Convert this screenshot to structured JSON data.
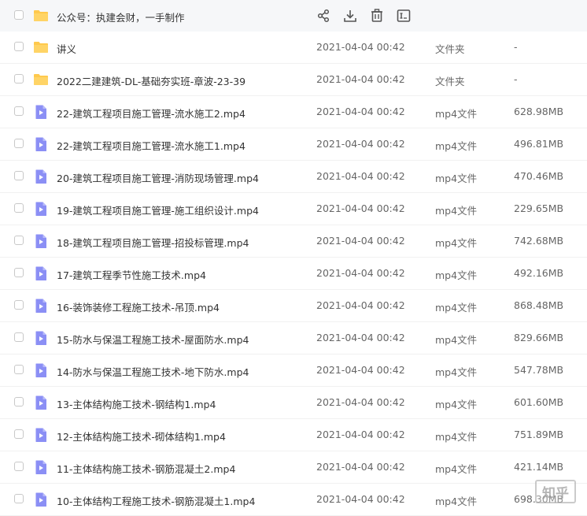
{
  "colors": {
    "folder": "#ffc94d",
    "video": "#8b8ff5",
    "selected_row_bg": "#f6f7f9"
  },
  "toolbar": {
    "icons": [
      "share-icon",
      "download-icon",
      "delete-icon",
      "rename-icon"
    ]
  },
  "rows": [
    {
      "name": "公众号：执建会财，一手制作",
      "kind": "folder",
      "date": "",
      "type": "",
      "size": ""
    },
    {
      "name": "讲义",
      "kind": "folder",
      "date": "2021-04-04 00:42",
      "type": "文件夹",
      "size": "-"
    },
    {
      "name": "2022二建建筑-DL-基础夯实班-章波-23-39",
      "kind": "folder",
      "date": "2021-04-04 00:42",
      "type": "文件夹",
      "size": "-"
    },
    {
      "name": "22-建筑工程项目施工管理-流水施工2.mp4",
      "kind": "video",
      "date": "2021-04-04 00:42",
      "type": "mp4文件",
      "size": "628.98MB"
    },
    {
      "name": "22-建筑工程项目施工管理-流水施工1.mp4",
      "kind": "video",
      "date": "2021-04-04 00:42",
      "type": "mp4文件",
      "size": "496.81MB"
    },
    {
      "name": "20-建筑工程项目施工管理-消防现场管理.mp4",
      "kind": "video",
      "date": "2021-04-04 00:42",
      "type": "mp4文件",
      "size": "470.46MB"
    },
    {
      "name": "19-建筑工程项目施工管理-施工组织设计.mp4",
      "kind": "video",
      "date": "2021-04-04 00:42",
      "type": "mp4文件",
      "size": "229.65MB"
    },
    {
      "name": "18-建筑工程项目施工管理-招投标管理.mp4",
      "kind": "video",
      "date": "2021-04-04 00:42",
      "type": "mp4文件",
      "size": "742.68MB"
    },
    {
      "name": "17-建筑工程季节性施工技术.mp4",
      "kind": "video",
      "date": "2021-04-04 00:42",
      "type": "mp4文件",
      "size": "492.16MB"
    },
    {
      "name": "16-装饰装修工程施工技术-吊顶.mp4",
      "kind": "video",
      "date": "2021-04-04 00:42",
      "type": "mp4文件",
      "size": "868.48MB"
    },
    {
      "name": "15-防水与保温工程施工技术-屋面防水.mp4",
      "kind": "video",
      "date": "2021-04-04 00:42",
      "type": "mp4文件",
      "size": "829.66MB"
    },
    {
      "name": "14-防水与保温工程施工技术-地下防水.mp4",
      "kind": "video",
      "date": "2021-04-04 00:42",
      "type": "mp4文件",
      "size": "547.78MB"
    },
    {
      "name": "13-主体结构施工技术-钢结构1.mp4",
      "kind": "video",
      "date": "2021-04-04 00:42",
      "type": "mp4文件",
      "size": "601.60MB"
    },
    {
      "name": "12-主体结构施工技术-砌体结构1.mp4",
      "kind": "video",
      "date": "2021-04-04 00:42",
      "type": "mp4文件",
      "size": "751.89MB"
    },
    {
      "name": "11-主体结构施工技术-钢筋混凝土2.mp4",
      "kind": "video",
      "date": "2021-04-04 00:42",
      "type": "mp4文件",
      "size": "421.14MB"
    },
    {
      "name": "10-主体结构工程施工技术-钢筋混凝土1.mp4",
      "kind": "video",
      "date": "2021-04-04 00:42",
      "type": "mp4文件",
      "size": "698.30MB"
    }
  ],
  "watermark": {
    "text": "知乎"
  }
}
